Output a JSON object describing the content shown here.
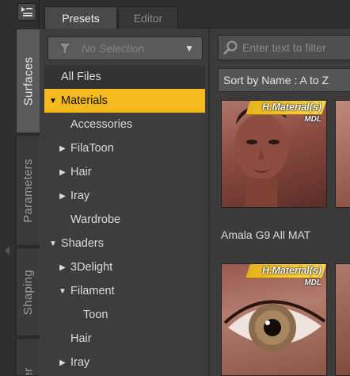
{
  "side_tabs": {
    "surfaces": "Surfaces",
    "parameters": "Parameters",
    "shaping": "Shaping",
    "partial": "er"
  },
  "panel_tabs": {
    "presets": "Presets",
    "editor": "Editor"
  },
  "selector": {
    "value": "No Selection"
  },
  "tree": [
    {
      "label": "All Files",
      "level": 0,
      "toggle": "",
      "state": "allfiles"
    },
    {
      "label": "Materials",
      "level": 0,
      "toggle": "▼",
      "state": "selected"
    },
    {
      "label": "Accessories",
      "level": 1,
      "toggle": "",
      "state": ""
    },
    {
      "label": "FilaToon",
      "level": 1,
      "toggle": "▶",
      "state": ""
    },
    {
      "label": "Hair",
      "level": 1,
      "toggle": "▶",
      "state": ""
    },
    {
      "label": "Iray",
      "level": 1,
      "toggle": "▶",
      "state": ""
    },
    {
      "label": "Wardrobe",
      "level": 1,
      "toggle": "",
      "state": ""
    },
    {
      "label": "Shaders",
      "level": 0,
      "toggle": "▼",
      "state": ""
    },
    {
      "label": "3Delight",
      "level": 1,
      "toggle": "▶",
      "state": ""
    },
    {
      "label": "Filament",
      "level": 1,
      "toggle": "▼",
      "state": ""
    },
    {
      "label": "Toon",
      "level": 2,
      "toggle": "",
      "state": ""
    },
    {
      "label": "Hair",
      "level": 1,
      "toggle": "",
      "state": ""
    },
    {
      "label": "Iray",
      "level": 1,
      "toggle": "▶",
      "state": ""
    }
  ],
  "search": {
    "placeholder": "Enter text to filter"
  },
  "sort": {
    "label": "Sort by Name : A to Z"
  },
  "thumbnails": [
    {
      "badge": "H.Material(s)",
      "sub": "MDL",
      "caption": "Amala G9 All MAT"
    },
    {
      "badge": "H.Material(s)",
      "sub": "MDL",
      "caption": ""
    }
  ],
  "colors": {
    "selection": "#f3b91d",
    "badge": "#ffd84a"
  }
}
